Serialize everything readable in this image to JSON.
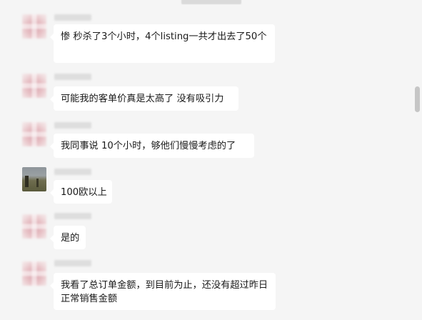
{
  "header": {
    "time_label": ""
  },
  "messages": [
    {
      "type": "blurred",
      "text": "惨  秒杀了3个小时，4个listing一共才出去了50个"
    },
    {
      "type": "blurred",
      "text": "可能我的客单价真是太高了 没有吸引力"
    },
    {
      "type": "blurred",
      "text": "我同事说  10个小时，够他们慢慢考虑的了"
    },
    {
      "type": "photo",
      "text": "100欧以上"
    },
    {
      "type": "blurred",
      "text": "是的"
    },
    {
      "type": "blurred",
      "text": "我看了总订单金额，到目前为止，还没有超过昨日正常销售金额"
    }
  ],
  "colors": {
    "background": "#f5f5f5",
    "bubble": "#ffffff",
    "text": "#1a1a1a",
    "scrollbar": "#c6c6c6"
  }
}
